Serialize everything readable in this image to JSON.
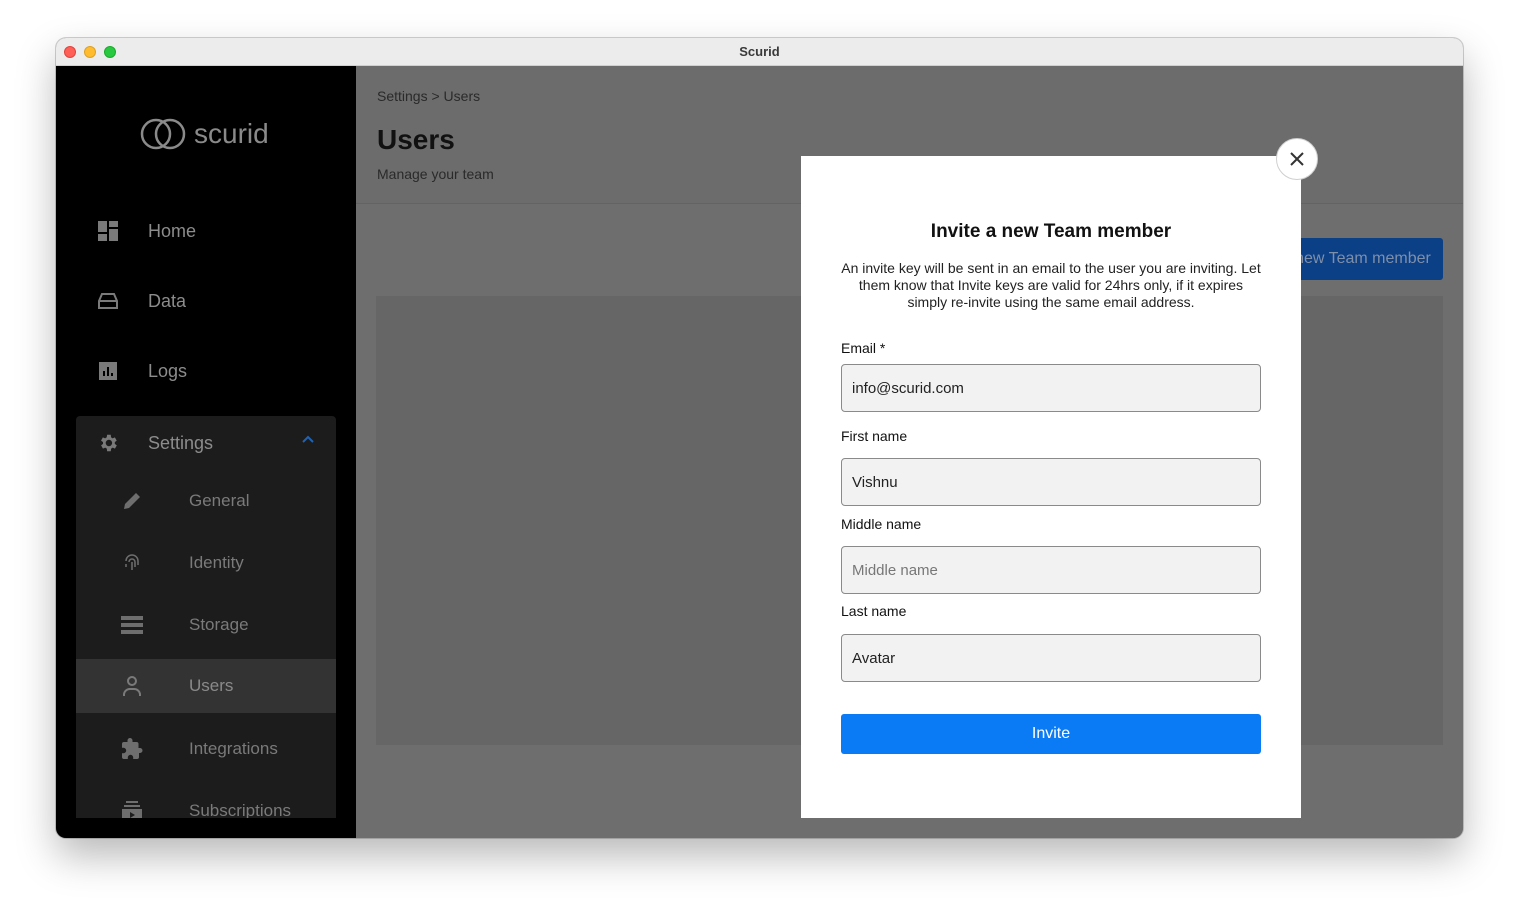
{
  "window": {
    "title": "Scurid"
  },
  "sidebar": {
    "logo_text": "scurid",
    "nav": [
      {
        "label": "Home",
        "icon": "dashboard-icon"
      },
      {
        "label": "Data",
        "icon": "drive-icon"
      },
      {
        "label": "Logs",
        "icon": "chart-icon"
      }
    ],
    "settings": {
      "label": "Settings",
      "icon": "gear-icon",
      "items": [
        {
          "label": "General",
          "icon": "pencil-icon"
        },
        {
          "label": "Identity",
          "icon": "fingerprint-icon"
        },
        {
          "label": "Storage",
          "icon": "storage-icon"
        },
        {
          "label": "Users",
          "icon": "person-icon",
          "active": true
        },
        {
          "label": "Integrations",
          "icon": "puzzle-icon"
        },
        {
          "label": "Subscriptions",
          "icon": "subscriptions-icon"
        }
      ]
    }
  },
  "main": {
    "breadcrumb": "Settings > Users",
    "title": "Users",
    "subtitle": "Manage your team",
    "add_button": "Add new Team member"
  },
  "modal": {
    "title": "Invite a new Team member",
    "description": "An invite key will be sent in an email to the user you are inviting. Let them know that Invite keys are valid for 24hrs only, if it expires simply re-invite using the same email address.",
    "fields": {
      "email": {
        "label": "Email *",
        "value": "info@scurid.com"
      },
      "first_name": {
        "label": "First name",
        "value": "Vishnu"
      },
      "middle_name": {
        "label": "Middle name",
        "value": "",
        "placeholder": "Middle name"
      },
      "last_name": {
        "label": "Last name",
        "value": "Avatar"
      }
    },
    "invite_button": "Invite"
  },
  "colors": {
    "accent": "#0a7bf5",
    "sidebar_bg": "#000000",
    "overlay": "#6e6e6e"
  }
}
